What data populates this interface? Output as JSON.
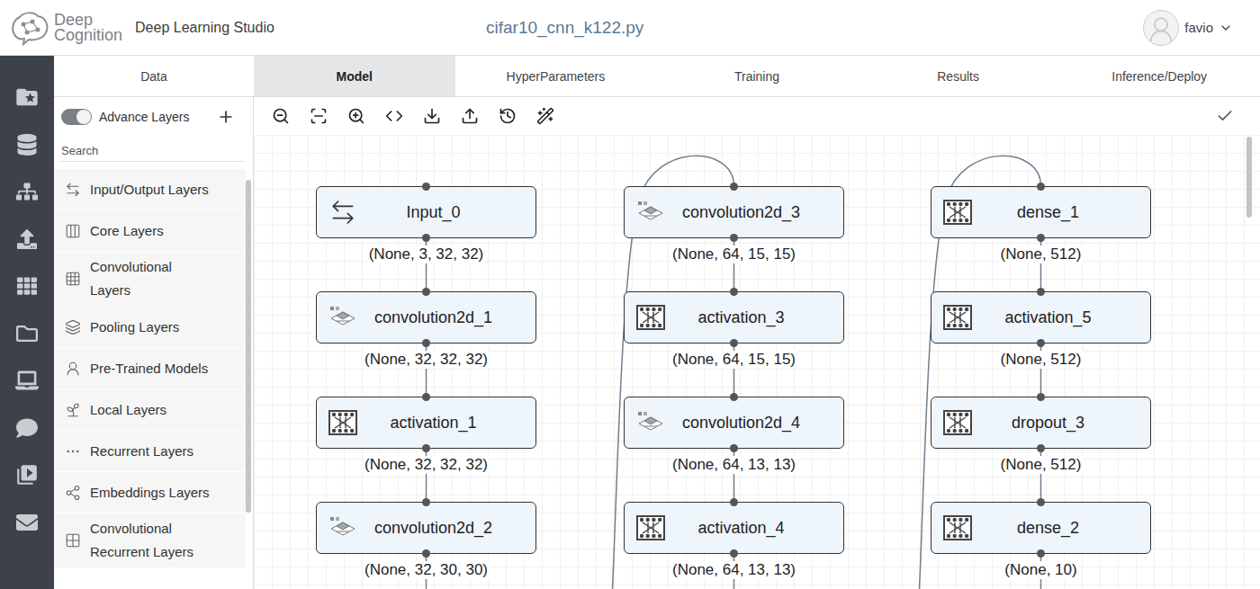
{
  "header": {
    "logo": {
      "line1": "Deep",
      "line2": "Cognition"
    },
    "product": "Deep Learning Studio",
    "file": "cifar10_cnn_k122.py",
    "user": "favio"
  },
  "tabs": [
    {
      "label": "Data",
      "selected": false
    },
    {
      "label": "Model",
      "selected": true
    },
    {
      "label": "HyperParameters",
      "selected": false
    },
    {
      "label": "Training",
      "selected": false
    },
    {
      "label": "Results",
      "selected": false
    },
    {
      "label": "Inference/Deploy",
      "selected": false
    }
  ],
  "sidebar": {
    "toggle": {
      "label": "Advance Layers",
      "on": true
    },
    "search": {
      "placeholder": "Search"
    },
    "items": [
      "Input/Output Layers",
      "Core Layers",
      "Convolutional Layers",
      "Pooling Layers",
      "Pre-Trained Models",
      "Local Layers",
      "Recurrent Layers",
      "Embeddings Layers",
      "Convolutional Recurrent Layers"
    ]
  },
  "canvas": {
    "columns": [
      {
        "nodes": [
          {
            "name": "Input_0",
            "shape": "(None, 3, 32, 32)",
            "kind": "input"
          },
          {
            "name": "convolution2d_1",
            "shape": "(None, 32, 32, 32)",
            "kind": "conv"
          },
          {
            "name": "activation_1",
            "shape": "(None, 32, 32, 32)",
            "kind": "core"
          },
          {
            "name": "convolution2d_2",
            "shape": "(None, 32, 30, 30)",
            "kind": "conv"
          }
        ]
      },
      {
        "nodes": [
          {
            "name": "convolution2d_3",
            "shape": "(None, 64, 15, 15)",
            "kind": "conv"
          },
          {
            "name": "activation_3",
            "shape": "(None, 64, 15, 15)",
            "kind": "core"
          },
          {
            "name": "convolution2d_4",
            "shape": "(None, 64, 13, 13)",
            "kind": "conv"
          },
          {
            "name": "activation_4",
            "shape": "(None, 64, 13, 13)",
            "kind": "core"
          }
        ]
      },
      {
        "nodes": [
          {
            "name": "dense_1",
            "shape": "(None, 512)",
            "kind": "core"
          },
          {
            "name": "activation_5",
            "shape": "(None, 512)",
            "kind": "core"
          },
          {
            "name": "dropout_3",
            "shape": "(None, 512)",
            "kind": "core"
          },
          {
            "name": "dense_2",
            "shape": "(None, 10)",
            "kind": "core"
          }
        ]
      }
    ]
  }
}
